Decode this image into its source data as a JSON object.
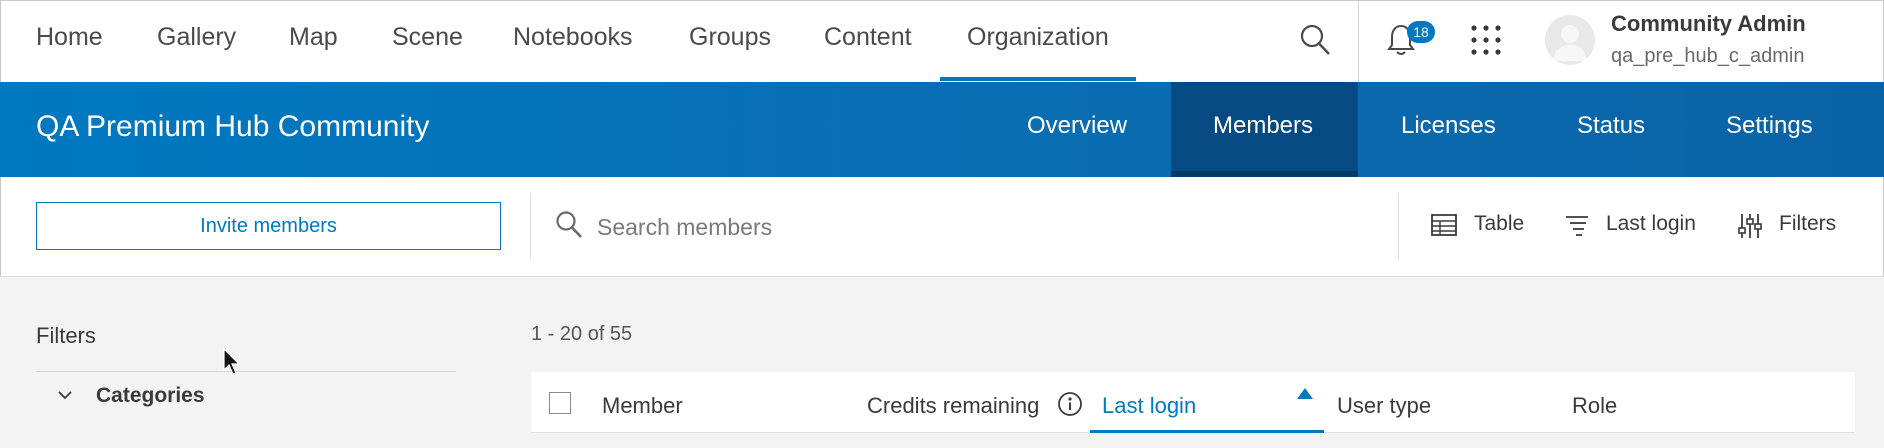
{
  "topnav": {
    "links": [
      "Home",
      "Gallery",
      "Map",
      "Scene",
      "Notebooks",
      "Groups",
      "Content",
      "Organization"
    ],
    "active": "Organization",
    "notification_count": "18",
    "icons": [
      "search-icon",
      "bell-icon",
      "app-launcher-icon",
      "avatar"
    ],
    "user": {
      "name": "Community Admin",
      "username": "qa_pre_hub_c_admin"
    }
  },
  "hub": {
    "title": "QA Premium Hub Community",
    "tabs": [
      "Overview",
      "Members",
      "Licenses",
      "Status",
      "Settings"
    ],
    "active_tab": "Members"
  },
  "toolbar": {
    "invite_label": "Invite members",
    "search_placeholder": "Search members",
    "view_label": "Table",
    "sort_label": "Last login",
    "filters_label": "Filters"
  },
  "sidebar": {
    "title": "Filters",
    "category_label": "Categories"
  },
  "results": {
    "count_text": "1 - 20 of 55",
    "columns": [
      "Member",
      "Credits remaining",
      "Last login",
      "User type",
      "Role"
    ],
    "sorted_column": "Last login",
    "sort_direction": "ascending"
  },
  "colors": {
    "accent": "#0079c1",
    "header_active": "#054a82",
    "background": "#f3f3f3"
  }
}
